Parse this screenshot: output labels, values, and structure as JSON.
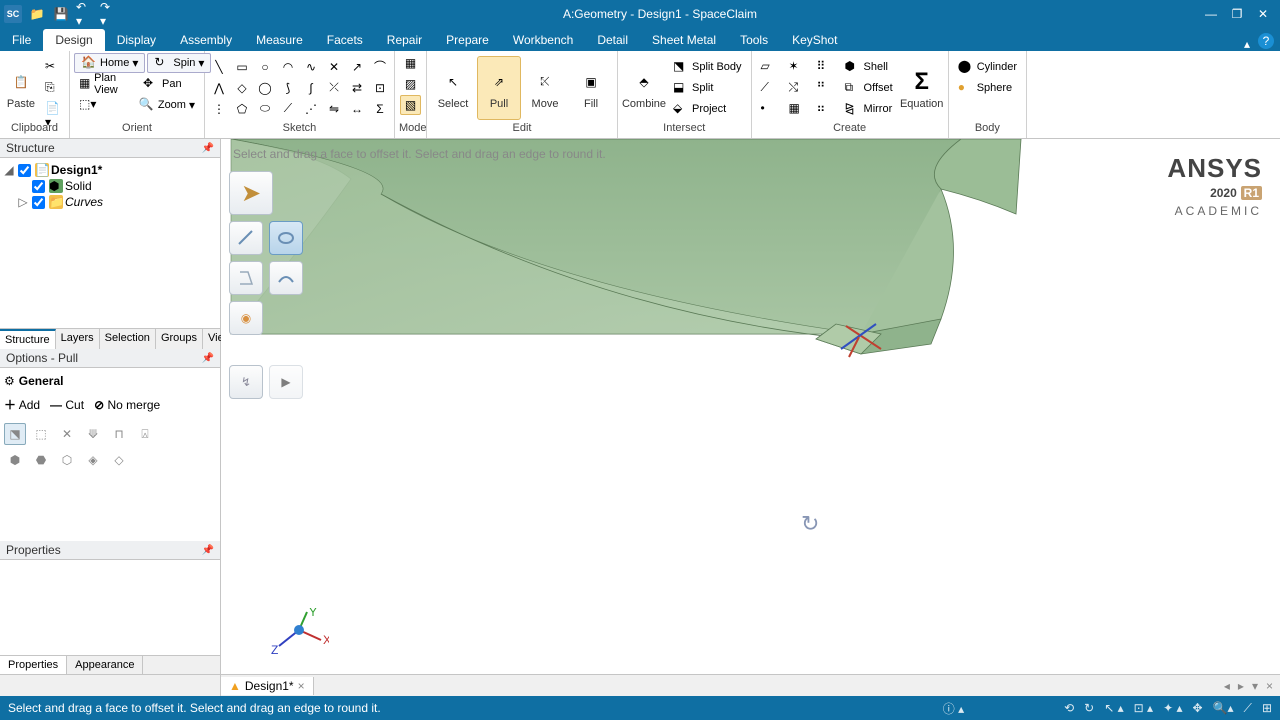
{
  "title": "A:Geometry - Design1 - SpaceClaim",
  "menus": [
    "File",
    "Design",
    "Display",
    "Assembly",
    "Measure",
    "Facets",
    "Repair",
    "Prepare",
    "Workbench",
    "Detail",
    "Sheet Metal",
    "Tools",
    "KeyShot"
  ],
  "active_menu": 1,
  "orient": {
    "home": "Home",
    "plan": "Plan View",
    "spin": "Spin",
    "pan": "Pan",
    "zoom": "Zoom"
  },
  "ribbon": {
    "clipboard": {
      "paste": "Paste",
      "label": "Clipboard"
    },
    "orient_label": "Orient",
    "sketch_label": "Sketch",
    "mode": {
      "label": "Mode"
    },
    "edit": {
      "select": "Select",
      "pull": "Pull",
      "move": "Move",
      "fill": "Fill",
      "label": "Edit"
    },
    "intersect": {
      "combine": "Combine",
      "split_body": "Split Body",
      "split": "Split",
      "project": "Project",
      "label": "Intersect"
    },
    "create": {
      "shell": "Shell",
      "offset": "Offset",
      "mirror": "Mirror",
      "equation": "Equation",
      "label": "Create"
    },
    "body": {
      "cylinder": "Cylinder",
      "sphere": "Sphere",
      "label": "Body"
    }
  },
  "structure": {
    "title": "Structure",
    "root": "Design1*",
    "items": [
      "Solid",
      "Curves"
    ]
  },
  "left_tabs": [
    "Structure",
    "Layers",
    "Selection",
    "Groups",
    "Views"
  ],
  "options": {
    "title": "Options - Pull",
    "general": "General",
    "add": "Add",
    "cut": "Cut",
    "nomerge": "No merge"
  },
  "properties_title": "Properties",
  "bottom_tabs": [
    "Properties",
    "Appearance"
  ],
  "viewport": {
    "hint": "Select and drag a face to offset it. Select and drag an edge to round it.",
    "logo": {
      "l1": "ANSYS",
      "l2a": "2020",
      "l2b": "R1",
      "l3": "ACADEMIC"
    }
  },
  "doc_tab": "Design1*",
  "status": "Select and drag a face to offset it. Select and drag an edge to round it."
}
